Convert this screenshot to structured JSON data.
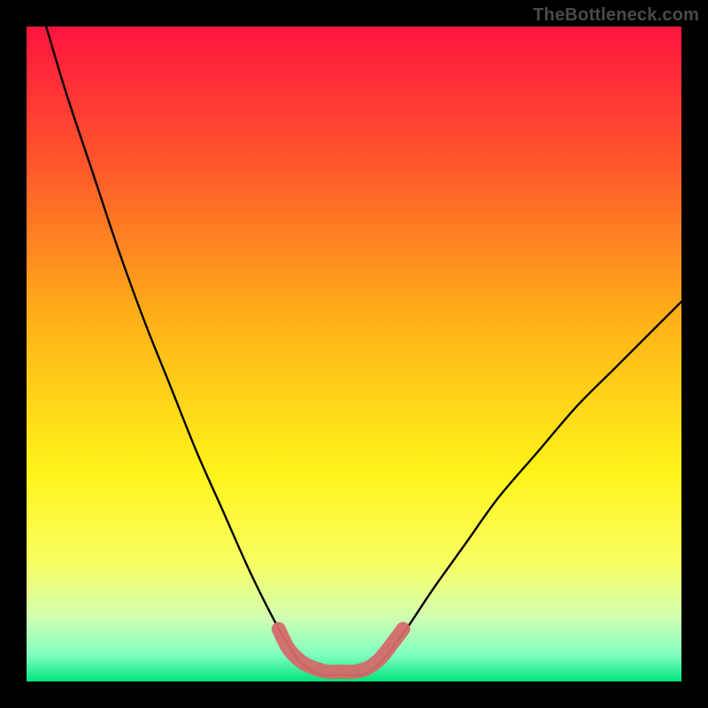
{
  "watermark": "TheBottleneck.com",
  "chart_data": {
    "type": "line",
    "title": "",
    "xlabel": "",
    "ylabel": "",
    "xlim": [
      0,
      100
    ],
    "ylim": [
      0,
      100
    ],
    "background_gradient": {
      "stops": [
        {
          "pos": 0.0,
          "color": "#ff143f"
        },
        {
          "pos": 0.22,
          "color": "#ff5a2a"
        },
        {
          "pos": 0.45,
          "color": "#ffb218"
        },
        {
          "pos": 0.68,
          "color": "#fff31a"
        },
        {
          "pos": 0.82,
          "color": "#f8ff63"
        },
        {
          "pos": 0.9,
          "color": "#d4ffb0"
        },
        {
          "pos": 0.96,
          "color": "#7fffc0"
        },
        {
          "pos": 1.0,
          "color": "#00e57a"
        }
      ]
    },
    "series": [
      {
        "name": "bottleneck-curve",
        "color": "#000000",
        "values": [
          {
            "x": 3,
            "y": 100
          },
          {
            "x": 6,
            "y": 90
          },
          {
            "x": 10,
            "y": 78
          },
          {
            "x": 14,
            "y": 66
          },
          {
            "x": 18,
            "y": 55
          },
          {
            "x": 22,
            "y": 45
          },
          {
            "x": 26,
            "y": 35
          },
          {
            "x": 30,
            "y": 26
          },
          {
            "x": 34,
            "y": 17
          },
          {
            "x": 38,
            "y": 9
          },
          {
            "x": 41,
            "y": 4
          },
          {
            "x": 43,
            "y": 2
          },
          {
            "x": 45,
            "y": 1
          },
          {
            "x": 48,
            "y": 1
          },
          {
            "x": 51,
            "y": 1
          },
          {
            "x": 53,
            "y": 2
          },
          {
            "x": 55,
            "y": 4
          },
          {
            "x": 58,
            "y": 8
          },
          {
            "x": 62,
            "y": 14
          },
          {
            "x": 67,
            "y": 21
          },
          {
            "x": 72,
            "y": 28
          },
          {
            "x": 78,
            "y": 35
          },
          {
            "x": 84,
            "y": 42
          },
          {
            "x": 90,
            "y": 48
          },
          {
            "x": 96,
            "y": 54
          },
          {
            "x": 100,
            "y": 58
          }
        ]
      }
    ],
    "highlight": {
      "name": "optimal-zone",
      "color": "#d46a6a",
      "points": [
        {
          "x": 38.5,
          "y": 8
        },
        {
          "x": 40,
          "y": 5
        },
        {
          "x": 42,
          "y": 3
        },
        {
          "x": 44,
          "y": 2
        },
        {
          "x": 46,
          "y": 1.5
        },
        {
          "x": 48,
          "y": 1.5
        },
        {
          "x": 50,
          "y": 1.5
        },
        {
          "x": 52,
          "y": 2
        },
        {
          "x": 54,
          "y": 3.5
        },
        {
          "x": 56,
          "y": 6
        },
        {
          "x": 57.5,
          "y": 8
        }
      ]
    }
  }
}
